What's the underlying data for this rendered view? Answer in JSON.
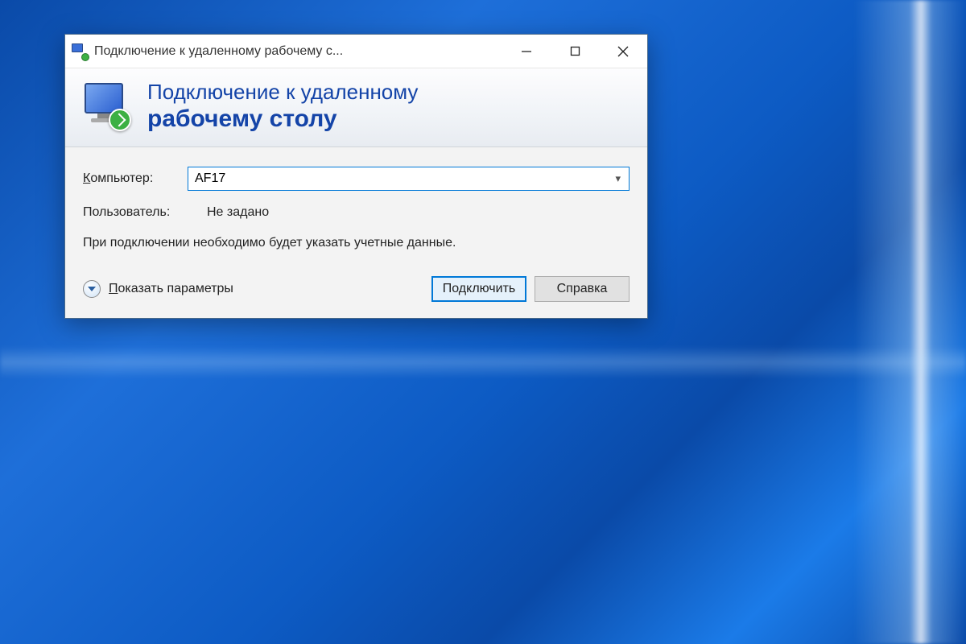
{
  "window": {
    "title": "Подключение к удаленному рабочему с..."
  },
  "banner": {
    "line1": "Подключение к удаленному",
    "line2": "рабочему столу"
  },
  "form": {
    "computer_label": "Компьютер:",
    "computer_value": "AF17",
    "user_label": "Пользователь:",
    "user_value": "Не задано",
    "info_text": "При подключении необходимо будет указать учетные данные."
  },
  "footer": {
    "show_options": "Показать параметры",
    "connect": "Подключить",
    "help": "Справка"
  }
}
